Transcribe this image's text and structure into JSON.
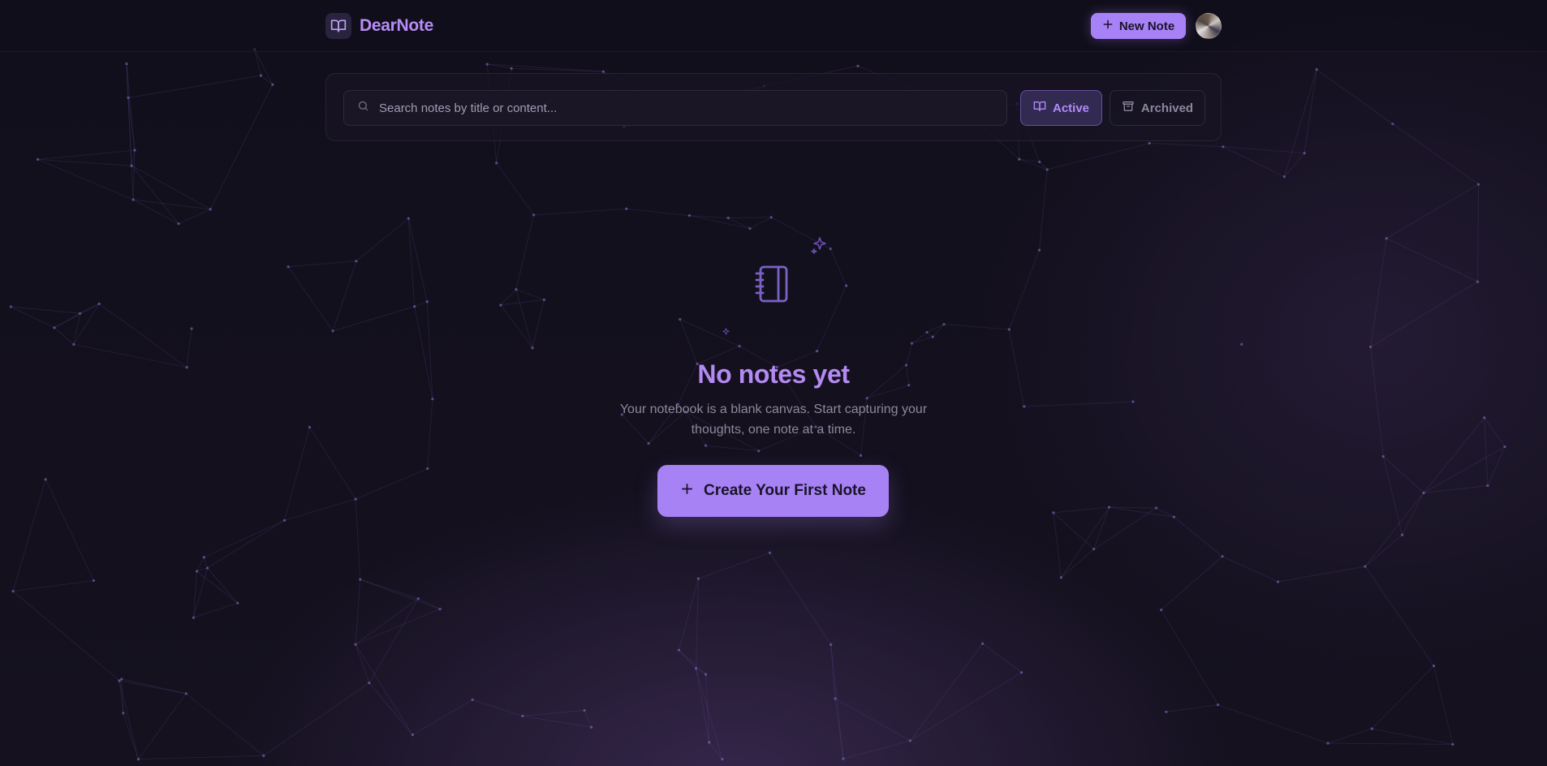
{
  "app": {
    "name": "DearNote",
    "accent": "#a781f6",
    "title_color": "#b88cf6"
  },
  "header": {
    "brand_icon": "open-book-icon",
    "new_note_label": "New Note",
    "new_note_icon": "plus-icon",
    "avatar": "user-avatar"
  },
  "filters": {
    "search_placeholder": "Search notes by title or content...",
    "search_value": "",
    "search_icon": "search-icon",
    "tabs": [
      {
        "label": "Active",
        "icon": "open-book-icon",
        "selected": true
      },
      {
        "label": "Archived",
        "icon": "archive-box-icon",
        "selected": false
      }
    ]
  },
  "empty_state": {
    "icon": "notebook-icon",
    "title": "No notes yet",
    "description": "Your notebook is a blank canvas. Start capturing your thoughts, one note at a time.",
    "cta_label": "Create Your First Note",
    "cta_icon": "plus-icon"
  }
}
